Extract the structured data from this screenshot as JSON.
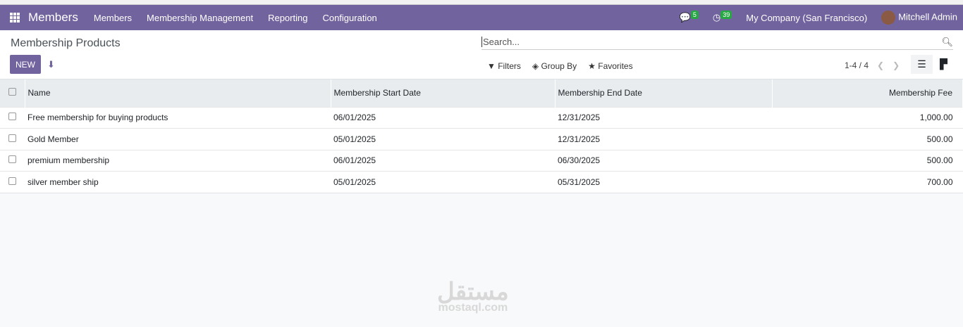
{
  "navbar": {
    "app": "Members",
    "menus": [
      "Members",
      "Membership Management",
      "Reporting",
      "Configuration"
    ],
    "messages_count": "5",
    "activities_count": "39",
    "company": "My Company (San Francisco)",
    "user": "Mitchell Admin"
  },
  "control": {
    "title": "Membership Products",
    "new_label": "NEW",
    "search_placeholder": "Search...",
    "filters": "Filters",
    "group_by": "Group By",
    "favorites": "Favorites",
    "pager": "1-4 / 4"
  },
  "table": {
    "headers": [
      "Name",
      "Membership Start Date",
      "Membership End Date",
      "Membership Fee"
    ],
    "rows": [
      {
        "name": "Free membership for buying products",
        "start": "06/01/2025",
        "end": "12/31/2025",
        "fee": "1,000.00"
      },
      {
        "name": "Gold Member",
        "start": "05/01/2025",
        "end": "12/31/2025",
        "fee": "500.00"
      },
      {
        "name": "premium membership",
        "start": "06/01/2025",
        "end": "06/30/2025",
        "fee": "500.00"
      },
      {
        "name": "silver member ship",
        "start": "05/01/2025",
        "end": "05/31/2025",
        "fee": "700.00"
      }
    ]
  },
  "watermark": {
    "arabic": "مستقل",
    "latin": "mostaql.com"
  }
}
